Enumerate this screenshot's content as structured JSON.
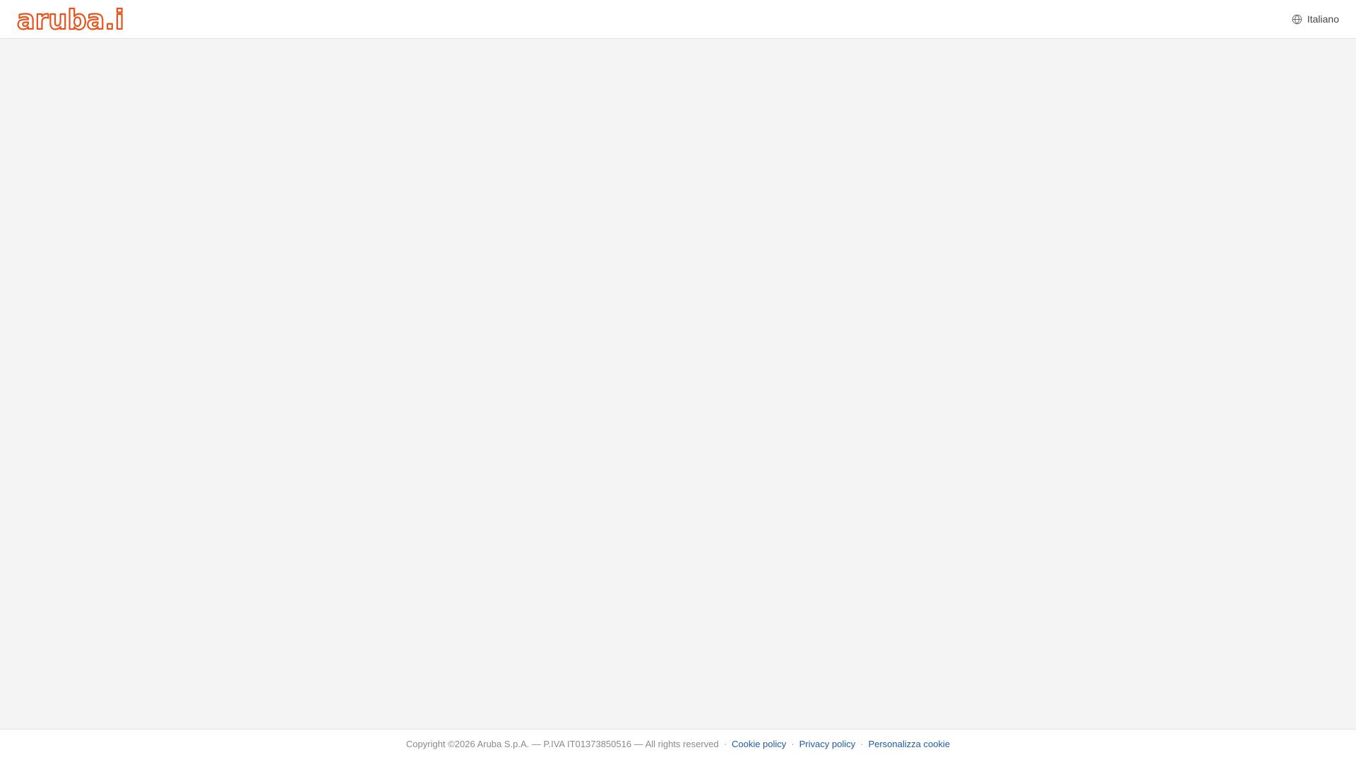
{
  "header": {
    "logo_text": "aruba.it",
    "language_label": "Italiano"
  },
  "footer": {
    "copyright": "Copyright ©2026 Aruba S.p.A. — P.IVA IT01373850516 — All rights reserved",
    "links": [
      {
        "label": "Cookie policy"
      },
      {
        "label": "Privacy policy"
      },
      {
        "label": "Personalizza cookie"
      }
    ],
    "separator": "·"
  },
  "colors": {
    "brand": "#e8531b",
    "link": "#1f5aa6",
    "background": "#f4f4f4"
  },
  "icons": {
    "language": "globe-icon"
  }
}
